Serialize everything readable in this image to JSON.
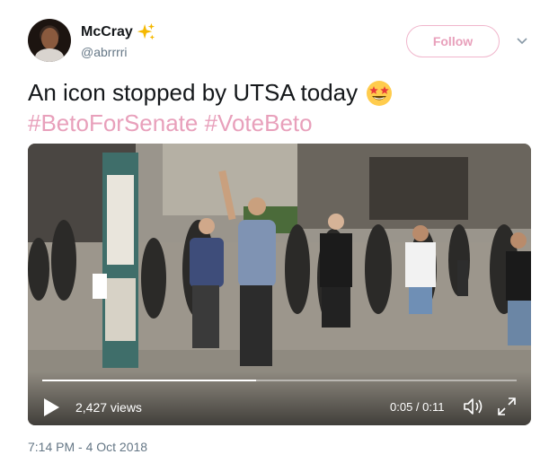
{
  "author": {
    "display_name": "McCray",
    "handle": "@abrrrri",
    "name_emoji": "sparkles-icon"
  },
  "follow_button": {
    "label": "Follow"
  },
  "tweet": {
    "text": "An icon stopped by UTSA today",
    "text_emoji": "star-struck-emoji-icon",
    "hashtags": [
      "#BetoForSenate",
      "#VoteBeto"
    ]
  },
  "video": {
    "views": "2,427 views",
    "time": "0:05 / 0:11",
    "progress": 0.45
  },
  "timestamp": "7:14 PM - 4 Oct 2018",
  "colors": {
    "accent_pink": "#e8a0bb",
    "text": "#14171a",
    "muted": "#657786"
  }
}
